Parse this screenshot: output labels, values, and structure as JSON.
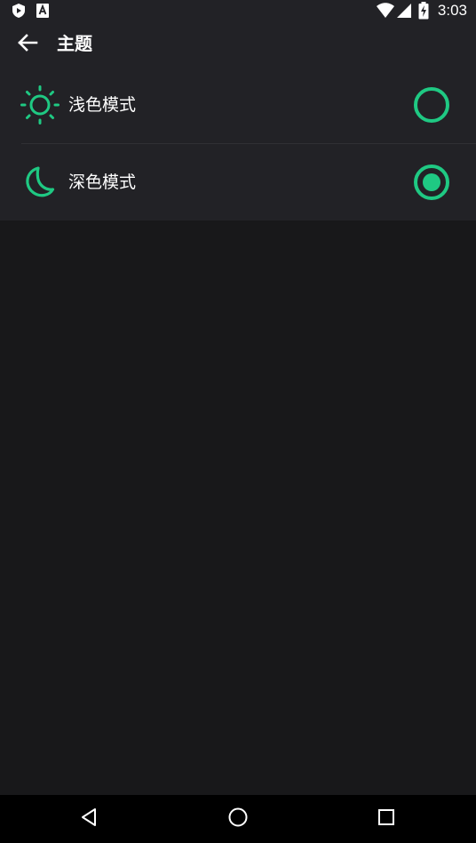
{
  "status_bar": {
    "time": "3:03",
    "left_icons": [
      "shield-app-icon",
      "font-app-icon"
    ],
    "right_icons": [
      "wifi-icon",
      "signal-icon",
      "battery-charging-icon"
    ]
  },
  "app_bar": {
    "title": "主题",
    "back_icon": "arrow-left-icon"
  },
  "theme_options": [
    {
      "label": "浅色模式",
      "icon": "sun-icon",
      "selected": false
    },
    {
      "label": "深色模式",
      "icon": "moon-icon",
      "selected": true
    }
  ],
  "nav_bar": {
    "buttons": [
      "back-triangle-icon",
      "home-circle-icon",
      "recents-square-icon"
    ]
  },
  "colors": {
    "accent": "#1fc983",
    "surface": "#222226",
    "background": "#18181a",
    "text": "#ffffff"
  }
}
